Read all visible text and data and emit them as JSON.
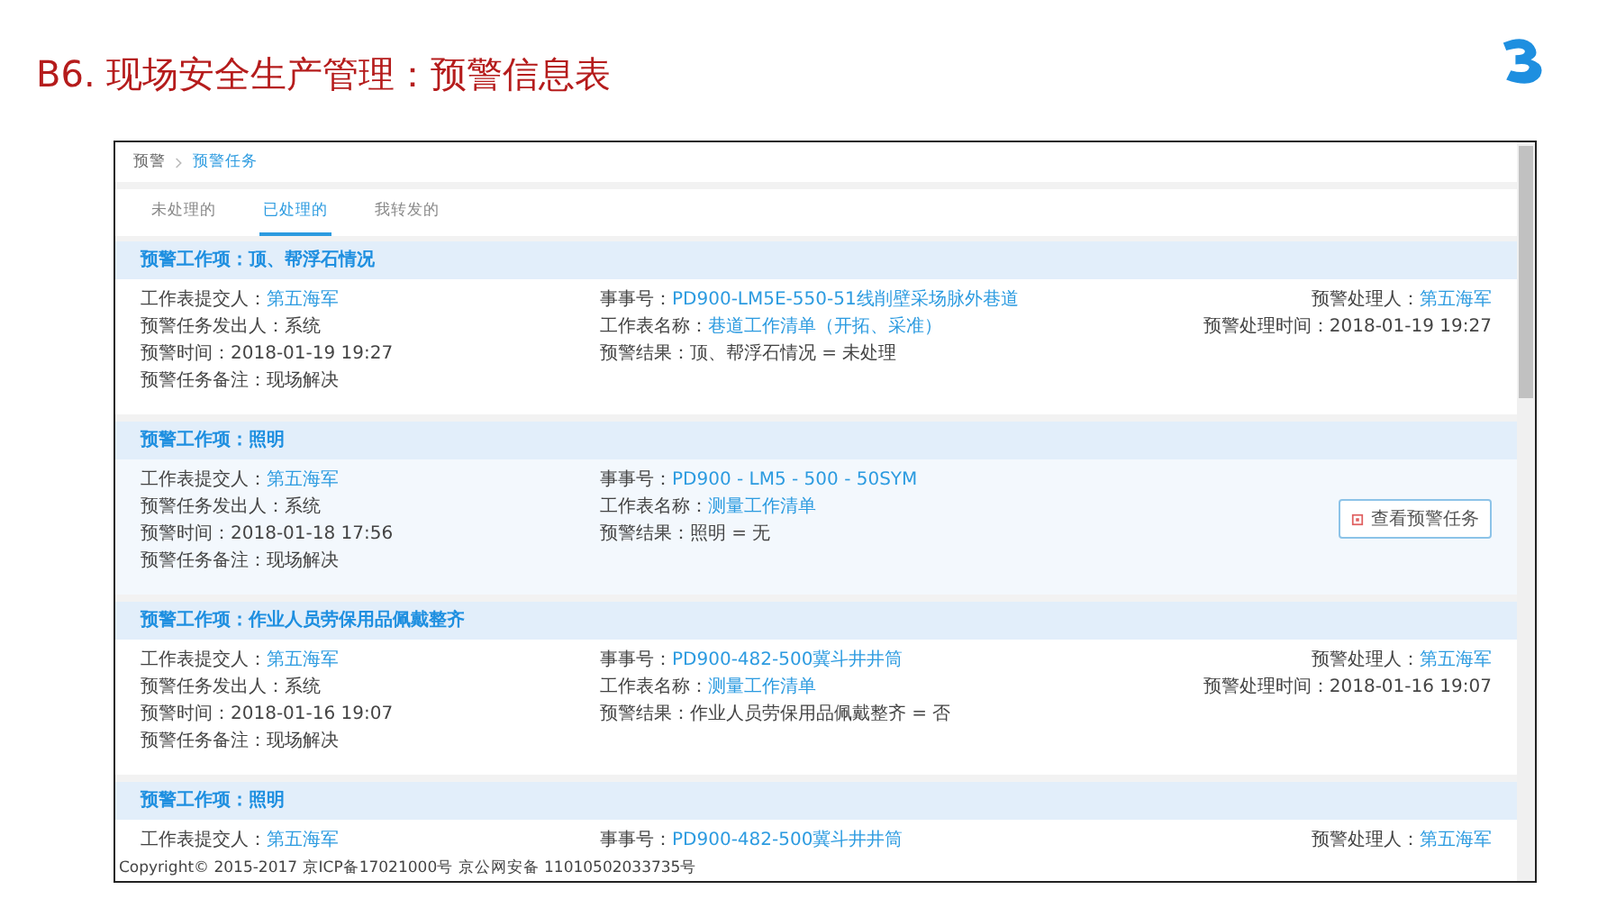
{
  "slide_title": "B6. 现场安全生产管理：预警信息表",
  "breadcrumb": [
    {
      "label": "预警",
      "kind": "plain"
    },
    {
      "label": "预警任务",
      "kind": "link"
    }
  ],
  "tabs": [
    {
      "label": "未处理的",
      "selected": false
    },
    {
      "label": "已处理的",
      "selected": true
    },
    {
      "label": "我转发的",
      "selected": false
    }
  ],
  "cards": [
    {
      "heading": "预警工作项：顶、帮浮石情况",
      "highlighted": false,
      "left": [
        {
          "label": "工作表提交人：",
          "value": "第五海军",
          "kind": "link"
        },
        {
          "label": "预警任务发出人：",
          "value": "系统",
          "kind": "plain"
        },
        {
          "label": "预警时间：",
          "value": "2018-01-19 19:27",
          "kind": "plain"
        },
        {
          "label": "预警任务备注：",
          "value": "现场解决",
          "kind": "plain"
        }
      ],
      "middle": [
        {
          "label": "事事号：",
          "value": "PD900-LM5E-550-51线削壁采场脉外巷道",
          "kind": "link"
        },
        {
          "label": "工作表名称：",
          "value": "巷道工作清单（开拓、采准）",
          "kind": "link"
        },
        {
          "label": "预警结果：",
          "value": "顶、帮浮石情况 = 未处理",
          "kind": "plain"
        }
      ],
      "right": [
        {
          "label": "预警处理人：",
          "value": "第五海军",
          "kind": "link"
        },
        {
          "label": "预警处理时间：",
          "value": "2018-01-19 19:27",
          "kind": "plain"
        }
      ]
    },
    {
      "heading": "预警工作项：照明",
      "highlighted": true,
      "left": [
        {
          "label": "工作表提交人：",
          "value": "第五海军",
          "kind": "link"
        },
        {
          "label": "预警任务发出人：",
          "value": "系统",
          "kind": "plain"
        },
        {
          "label": "预警时间：",
          "value": "2018-01-18 17:56",
          "kind": "plain"
        },
        {
          "label": "预警任务备注：",
          "value": "现场解决",
          "kind": "plain"
        }
      ],
      "middle": [
        {
          "label": "事事号：",
          "value": "PD900 - LM5 - 500 - 50SYM",
          "kind": "link"
        },
        {
          "label": "工作表名称：",
          "value": "测量工作清单",
          "kind": "link"
        },
        {
          "label": "预警结果：",
          "value": "照明 = 无",
          "kind": "plain"
        }
      ],
      "button": "查看预警任务"
    },
    {
      "heading": "预警工作项：作业人员劳保用品佩戴整齐",
      "highlighted": false,
      "left": [
        {
          "label": "工作表提交人：",
          "value": "第五海军",
          "kind": "link"
        },
        {
          "label": "预警任务发出人：",
          "value": "系统",
          "kind": "plain"
        },
        {
          "label": "预警时间：",
          "value": "2018-01-16 19:07",
          "kind": "plain"
        },
        {
          "label": "预警任务备注：",
          "value": "现场解决",
          "kind": "plain"
        }
      ],
      "middle": [
        {
          "label": "事事号：",
          "value": "PD900-482-500冀斗井井筒",
          "kind": "link"
        },
        {
          "label": "工作表名称：",
          "value": "测量工作清单",
          "kind": "link"
        },
        {
          "label": "预警结果：",
          "value": "作业人员劳保用品佩戴整齐 = 否",
          "kind": "plain"
        }
      ],
      "right": [
        {
          "label": "预警处理人：",
          "value": "第五海军",
          "kind": "link"
        },
        {
          "label": "预警处理时间：",
          "value": "2018-01-16 19:07",
          "kind": "plain"
        }
      ]
    },
    {
      "heading": "预警工作项：照明",
      "highlighted": false,
      "left": [
        {
          "label": "工作表提交人：",
          "value": "第五海军",
          "kind": "link"
        }
      ],
      "middle": [
        {
          "label": "事事号：",
          "value": "PD900-482-500冀斗井井筒",
          "kind": "link"
        }
      ],
      "right": [
        {
          "label": "预警处理人：",
          "value": "第五海军",
          "kind": "link"
        }
      ]
    }
  ],
  "footer": "Copyright© 2015-2017  京ICP备17021000号  京公网安备 11010502033735号"
}
